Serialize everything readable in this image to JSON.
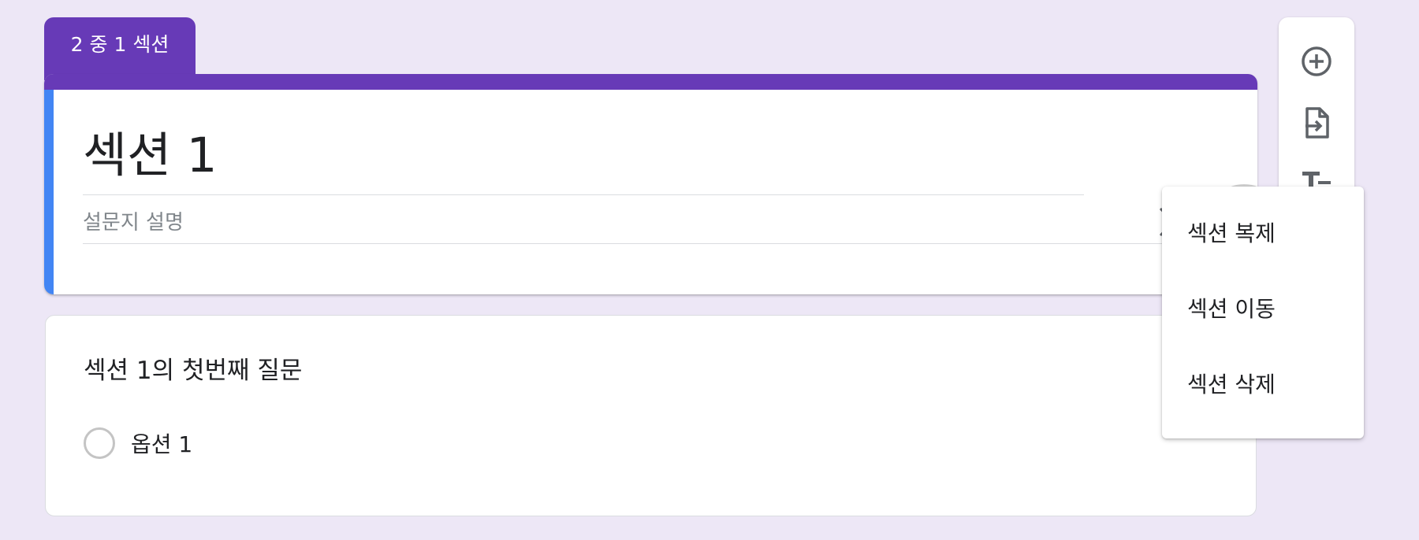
{
  "section_tab": {
    "label": "2 중 1 섹션"
  },
  "section": {
    "title": "섹션 1",
    "description_placeholder": "설문지 설명"
  },
  "question": {
    "title": "섹션 1의 첫번째 질문",
    "options": [
      "옵션 1"
    ]
  },
  "section_menu": {
    "items": [
      "섹션 복제",
      "섹션 이동",
      "섹션 삭제"
    ]
  },
  "side_toolbar": {
    "tools": [
      "add-question-icon",
      "import-questions-icon",
      "add-title-icon"
    ]
  },
  "colors": {
    "background": "#ede7f6",
    "accent": "#673ab7",
    "focus": "#4285f4"
  }
}
